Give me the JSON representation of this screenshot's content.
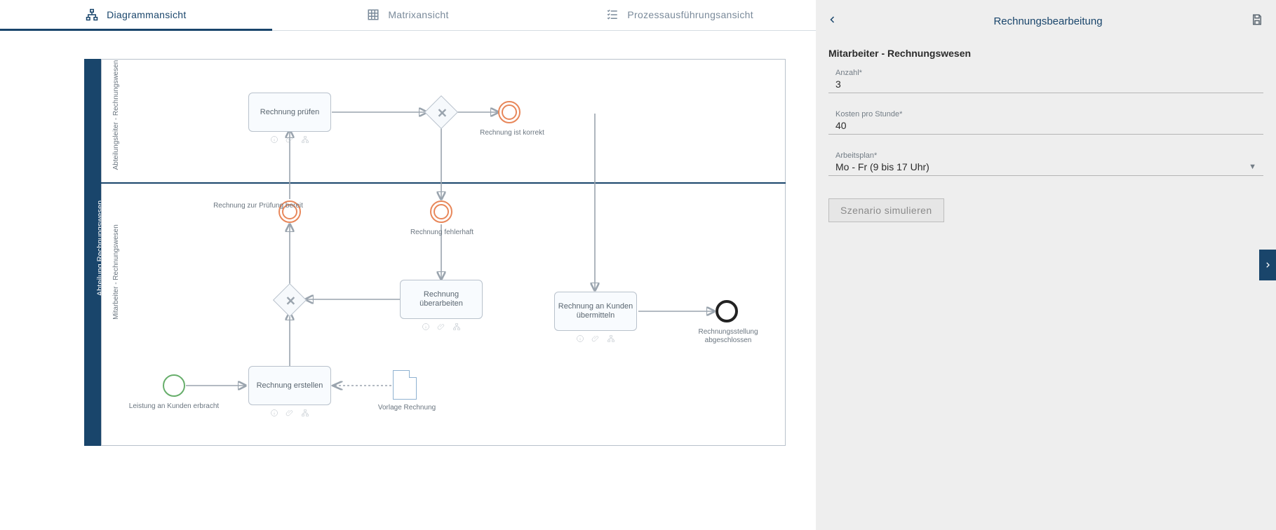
{
  "tabs": {
    "diagram": "Diagrammansicht",
    "matrix": "Matrixansicht",
    "exec": "Prozessausführungsansicht",
    "active": "diagram"
  },
  "pool": {
    "label": "Abteilung Rechnungswesen"
  },
  "lanes": {
    "top": "Abteilungsleiter - Rechnungswesen",
    "bottom": "Mitarbeiter - Rechnungswesen"
  },
  "tasks": {
    "pruefen": "Rechnung prüfen",
    "erstellen": "Rechnung erstellen",
    "ueberarb": "Rechnung überarbeiten",
    "uebermitteln": "Rechnung an Kunden übermitteln"
  },
  "events": {
    "start": "Leistung an Kunden erbracht",
    "bereit": "Rechnung zur Prüfung bereit",
    "fehlerhaft": "Rechnung fehlerhaft",
    "korrekt": "Rechnung ist korrekt",
    "end": "Rechnungsstellung abgeschlossen"
  },
  "dataobj": {
    "vorlage": "Vorlage Rechnung"
  },
  "panel": {
    "title": "Rechnungsbearbeitung",
    "section": "Mitarbeiter - Rechnungswesen",
    "anzahl_label": "Anzahl*",
    "anzahl_value": "3",
    "kosten_label": "Kosten pro Stunde*",
    "kosten_value": "40",
    "plan_label": "Arbeitsplan*",
    "plan_value": "Mo - Fr (9 bis 17 Uhr)",
    "simulate": "Szenario simulieren"
  }
}
